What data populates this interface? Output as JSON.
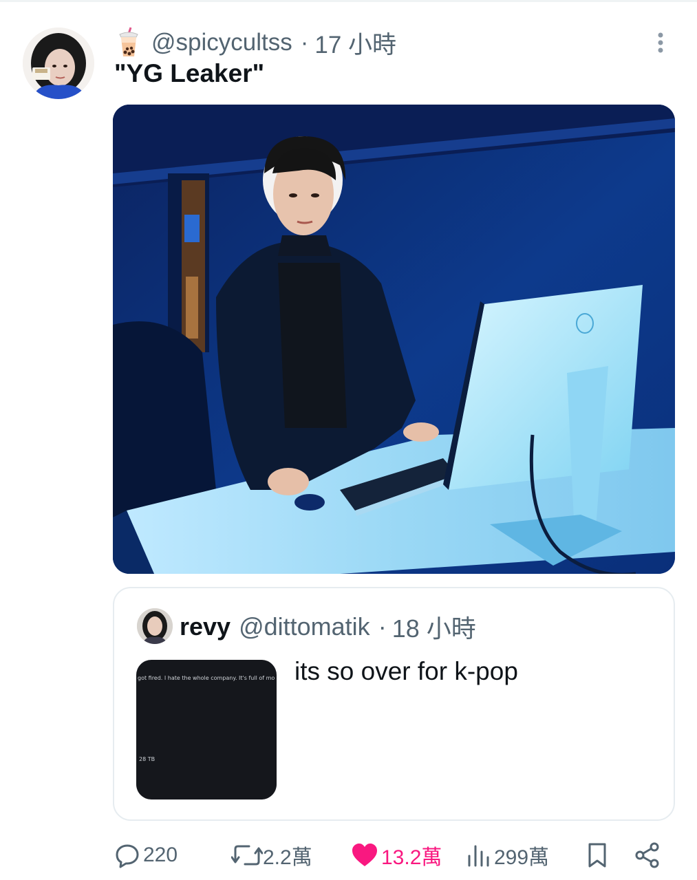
{
  "post": {
    "handle": "@spicycultss",
    "separator": "·",
    "time": "17 小時",
    "text": "\"YG Leaker\"",
    "avatar_icon": "user-avatar-photo",
    "badge_icon": "bubble-tea-emoji-icon",
    "more_icon": "vertical-dots-icon"
  },
  "media": {
    "description_icon": "photo-man-at-computer"
  },
  "quote": {
    "name": "revy",
    "handle": "@dittomatik",
    "separator": "·",
    "time": "18 小時",
    "text": "its so over for k-pop",
    "thumb_line": "got fired. I hate the whole company. It's full of mo",
    "thumb_size": "28 TB"
  },
  "actions": {
    "reply_count": "220",
    "repost_count": "2.2萬",
    "like_count": "13.2萬",
    "view_count": "299萬"
  },
  "colors": {
    "muted": "#536471",
    "text": "#0f1419",
    "like": "#f91880",
    "border": "#e6ecf0"
  }
}
